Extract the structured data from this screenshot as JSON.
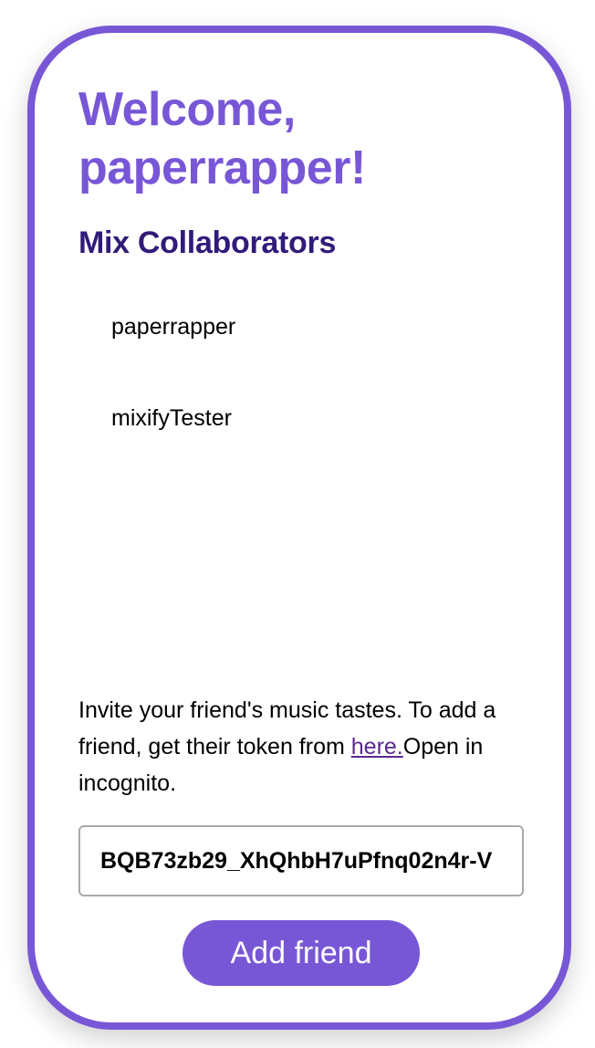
{
  "welcome": {
    "title": "Welcome, paperrapper!"
  },
  "collaborators": {
    "heading": "Mix Collaborators",
    "items": [
      "paperrapper",
      "mixifyTester"
    ]
  },
  "invite": {
    "text_before": "Invite your friend's music tastes. To add a friend, get their token from ",
    "link_label": "here.",
    "text_after": "Open in incognito."
  },
  "token_field": {
    "value": "BQB73zb29_XhQhbH7uPfnq02n4r-V"
  },
  "add_button": {
    "label": "Add friend"
  },
  "colors": {
    "accent": "#7857d6",
    "heading_dark": "#311b7a",
    "link": "#5b2a8f"
  }
}
